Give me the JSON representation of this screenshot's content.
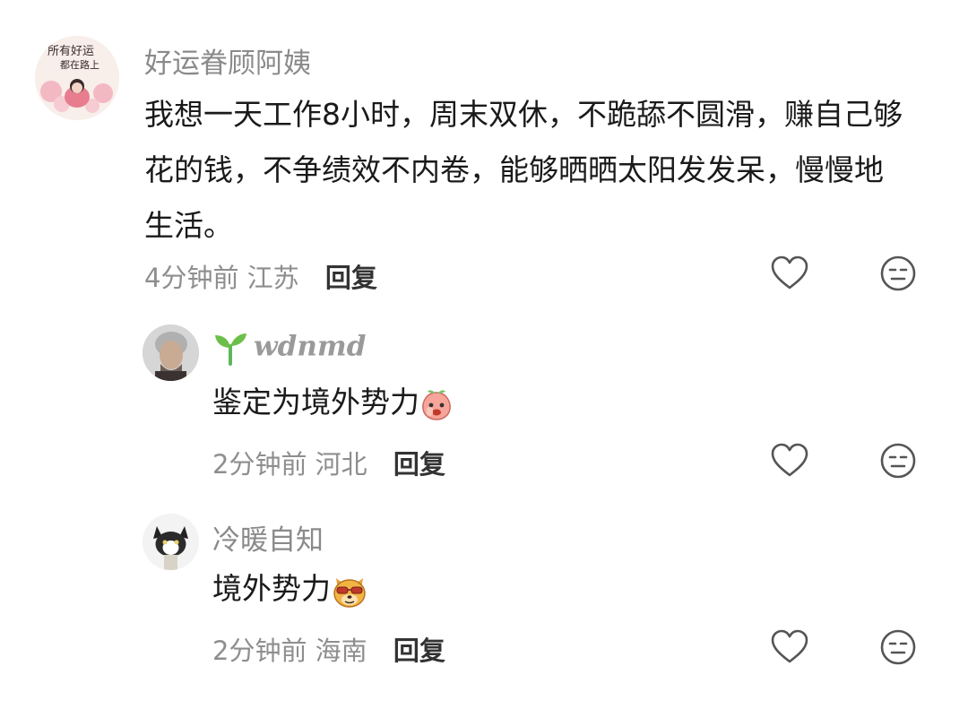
{
  "comments": [
    {
      "username": "好运眷顾阿姨",
      "text": "我想一天工作8小时，周末双休，不跪舔不圆滑，赚自己够花的钱，不争绩效不内卷，能够晒晒太阳发发呆，慢慢地生活。",
      "time": "4分钟前",
      "location": "江苏",
      "reply_label": "回复",
      "avatar_text": [
        "所有好运",
        "都在路上"
      ]
    },
    {
      "username": "wdnmd",
      "text": "鉴定为境外势力",
      "time": "2分钟前",
      "location": "河北",
      "reply_label": "回复",
      "emoji_icon": "peach-face-icon"
    },
    {
      "username": "冷暖自知",
      "text": "境外势力",
      "time": "2分钟前",
      "location": "海南",
      "reply_label": "回复",
      "emoji_icon": "dog-sunglasses-icon"
    }
  ],
  "icons": {
    "like": "heart-outline-icon",
    "dislike": "neutral-face-icon",
    "sprout": "sprout-badge-icon"
  },
  "colors": {
    "username": "#8a8a8a",
    "meta": "#8e8e8e",
    "reply": "#333333",
    "icon": "#555555"
  }
}
